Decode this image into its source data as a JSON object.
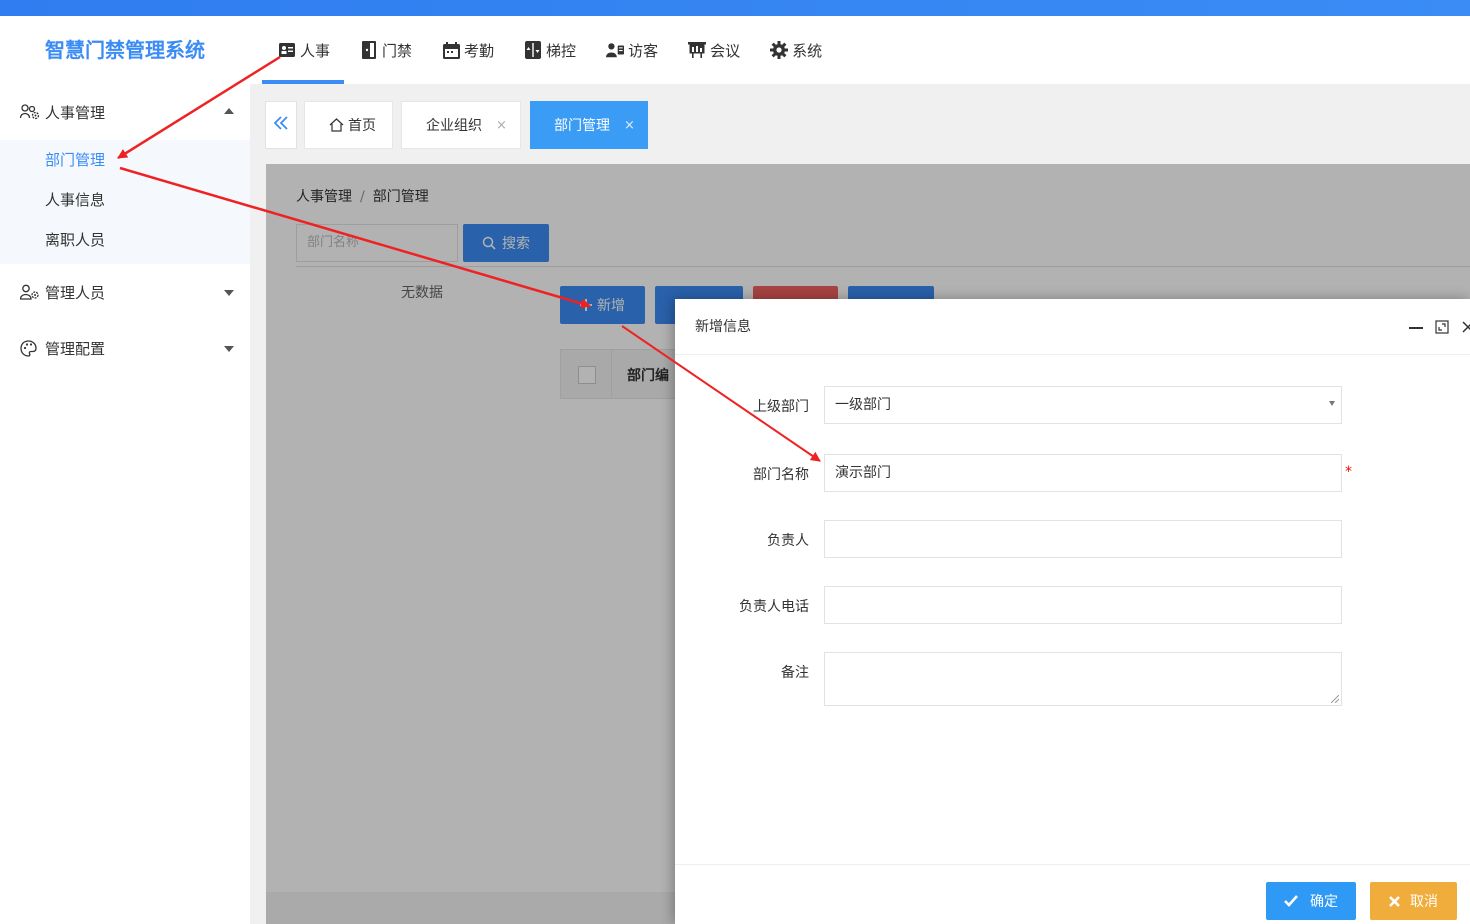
{
  "app": {
    "title": "智慧门禁管理系统"
  },
  "topnav": [
    {
      "label": "人事",
      "icon": "id-card-icon"
    },
    {
      "label": "门禁",
      "icon": "door-icon"
    },
    {
      "label": "考勤",
      "icon": "calendar-icon"
    },
    {
      "label": "梯控",
      "icon": "elevator-icon"
    },
    {
      "label": "访客",
      "icon": "visitor-icon"
    },
    {
      "label": "会议",
      "icon": "presentation-icon"
    },
    {
      "label": "系统",
      "icon": "gear-icon"
    }
  ],
  "sidebar": {
    "groups": [
      {
        "label": "人事管理",
        "icon": "users-gear-icon",
        "expanded": true,
        "items": [
          {
            "label": "部门管理",
            "active": true
          },
          {
            "label": "人事信息"
          },
          {
            "label": "离职人员"
          }
        ]
      },
      {
        "label": "管理人员",
        "icon": "user-gear-icon",
        "expanded": false
      },
      {
        "label": "管理配置",
        "icon": "palette-icon",
        "expanded": false
      }
    ]
  },
  "tabs": [
    {
      "label": "首页",
      "icon": "home-icon"
    },
    {
      "label": "企业组织",
      "close": "×"
    },
    {
      "label": "部门管理",
      "close": "×",
      "active": true
    }
  ],
  "content": {
    "breadcrumb": [
      "人事管理",
      "部门管理"
    ],
    "breadcrumb_sep": "/",
    "search": {
      "placeholder": "部门名称",
      "button": "搜索"
    },
    "nodata": "无数据",
    "add_button": "新增",
    "table_col1": "部门编"
  },
  "modal": {
    "title": "新增信息",
    "fields": {
      "parent": {
        "label": "上级部门",
        "value": "一级部门"
      },
      "name": {
        "label": "部门名称",
        "value": "演示部门",
        "required": "*"
      },
      "owner": {
        "label": "负责人",
        "value": ""
      },
      "phone": {
        "label": "负责人电话",
        "value": ""
      },
      "remark": {
        "label": "备注",
        "value": ""
      }
    },
    "ok": "确定",
    "cancel": "取消"
  },
  "colors": {
    "primary": "#3b8cf5",
    "active_tab": "#3b9cf5",
    "warning": "#f0ad3b",
    "annotation": "#ee2222"
  }
}
